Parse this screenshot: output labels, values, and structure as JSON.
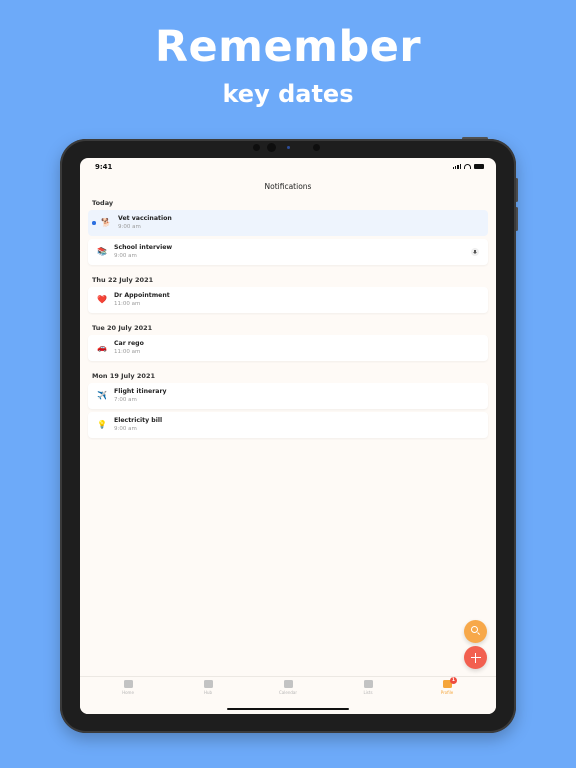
{
  "promo": {
    "headline": "Remember",
    "subheadline": "key dates"
  },
  "status_bar": {
    "time": "9:41"
  },
  "screen": {
    "title": "Notifications"
  },
  "sections": [
    {
      "header": "Today",
      "items": [
        {
          "emoji": "🐕",
          "title": "Vet vaccination",
          "time": "9:00 am",
          "unread": true,
          "highlighted": true
        },
        {
          "emoji": "📚",
          "title": "School interview",
          "time": "9:00 am",
          "attachment": true
        }
      ]
    },
    {
      "header": "Thu 22 July 2021",
      "items": [
        {
          "emoji": "❤️",
          "title": "Dr Appointment",
          "time": "11:00 am"
        }
      ]
    },
    {
      "header": "Tue 20 July 2021",
      "items": [
        {
          "emoji": "🚗",
          "title": "Car rego",
          "time": "11:00 am"
        }
      ]
    },
    {
      "header": "Mon 19 July 2021",
      "items": [
        {
          "emoji": "✈️",
          "title": "Flight itinerary",
          "time": "7:00 am"
        },
        {
          "emoji": "💡",
          "title": "Electricity bill",
          "time": "9:00 am"
        }
      ]
    }
  ],
  "tab_bar": {
    "tabs": [
      {
        "label": "Home",
        "icon": "home-icon"
      },
      {
        "label": "Hub",
        "icon": "grid-icon"
      },
      {
        "label": "Calendar",
        "icon": "calendar-icon"
      },
      {
        "label": "Lists",
        "icon": "list-icon"
      },
      {
        "label": "Profile",
        "icon": "profile-icon",
        "active": true,
        "badge": "1"
      }
    ]
  },
  "colors": {
    "background": "#6daaf9",
    "accent_orange": "#f5a53a",
    "fab_add": "#f26050",
    "unread": "#2b6fe0"
  }
}
